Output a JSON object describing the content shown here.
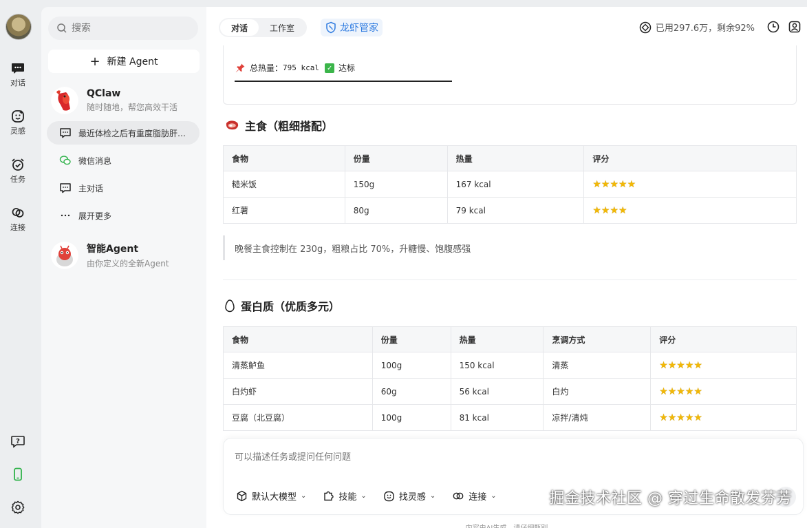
{
  "rail": {
    "items": [
      {
        "label": "对话",
        "icon": "chat-bubble-icon"
      },
      {
        "label": "灵感",
        "icon": "smile-icon"
      },
      {
        "label": "任务",
        "icon": "alarm-clock-icon"
      },
      {
        "label": "连接",
        "icon": "link-icon"
      }
    ],
    "bottom_icons": [
      "help-icon",
      "phone-icon",
      "settings-icon"
    ]
  },
  "sidebar": {
    "search_placeholder": "搜索",
    "new_agent_label": "新建 Agent",
    "agents": [
      {
        "name": "QClaw",
        "desc": "随时随地，帮您高效干活"
      },
      {
        "name": "智能Agent",
        "desc": "由你定义的全新Agent"
      }
    ],
    "items": [
      {
        "label": "最近体检之后有重度脂肪肝…",
        "icon": "chat-icon",
        "active": true
      },
      {
        "label": "微信消息",
        "icon": "wechat-icon"
      },
      {
        "label": "主对话",
        "icon": "chat-icon"
      },
      {
        "label": "展开更多",
        "icon": "more-icon"
      }
    ]
  },
  "header": {
    "tabs": [
      "对话",
      "工作室"
    ],
    "brand": "龙虾管家",
    "usage": "已用297.6万，剩余92%"
  },
  "content": {
    "calorie_label": "总热量：",
    "calorie_value": "795 kcal",
    "calorie_status": "达标",
    "staple": {
      "title": "主食（粗细搭配）",
      "headers": [
        "食物",
        "份量",
        "热量",
        "评分"
      ],
      "rows": [
        [
          "糙米饭",
          "150g",
          "167 kcal",
          "★★★★★"
        ],
        [
          "红薯",
          "80g",
          "79 kcal",
          "★★★★"
        ]
      ],
      "note": "晚餐主食控制在 230g，粗粮占比 70%，升糖慢、饱腹感强"
    },
    "protein": {
      "title": "蛋白质（优质多元）",
      "headers": [
        "食物",
        "份量",
        "热量",
        "烹调方式",
        "评分"
      ],
      "rows": [
        [
          "清蒸鲈鱼",
          "100g",
          "150 kcal",
          "清蒸",
          "★★★★★"
        ],
        [
          "白灼虾",
          "60g",
          "56 kcal",
          "白灼",
          "★★★★★"
        ],
        [
          "豆腐（北豆腐）",
          "100g",
          "81 kcal",
          "凉拌/清炖",
          "★★★★★"
        ]
      ]
    }
  },
  "composer": {
    "placeholder": "可以描述任务或提问任何问题",
    "tools": [
      "默认大模型",
      "技能",
      "找灵感",
      "连接"
    ],
    "disclaimer": "内容由AI生成，请仔细甄别"
  },
  "watermark": "掘金技术社区 @ 穿过生命散发芬芳"
}
